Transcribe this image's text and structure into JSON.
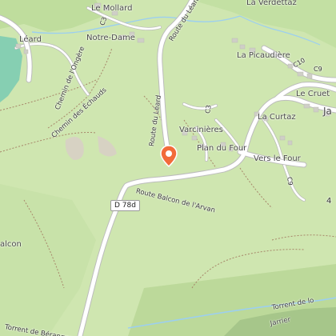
{
  "map": {
    "places": [
      {
        "id": "le-mollard",
        "name": "Le Mollard"
      },
      {
        "id": "la-verdettaz",
        "name": "La Verdettaz"
      },
      {
        "id": "leard",
        "name": "Léard"
      },
      {
        "id": "notre-dame",
        "name": "Notre-Dame"
      },
      {
        "id": "la-picaudiere",
        "name": "La Picaudière"
      },
      {
        "id": "le-cruet",
        "name": "Le Cruet"
      },
      {
        "id": "la-curtaz",
        "name": "La Curtaz"
      },
      {
        "id": "varcinieres",
        "name": "Varcinières"
      },
      {
        "id": "plan-du-four",
        "name": "Plan du Four"
      },
      {
        "id": "vers-le-four",
        "name": "Vers le Four"
      },
      {
        "id": "balcon",
        "name": "alcon"
      },
      {
        "id": "jarrier-partial",
        "name": "Ja"
      },
      {
        "id": "jarrier",
        "name": "Jarrier"
      }
    ],
    "roads": [
      {
        "id": "route-du-leard-top",
        "name": "Route du Léard"
      },
      {
        "id": "route-du-leard-mid",
        "name": "Route du Léard"
      },
      {
        "id": "chemin-ongere",
        "name": "Chemin de l'Ongère"
      },
      {
        "id": "chemin-echauds",
        "name": "Chemin des Échauds"
      },
      {
        "id": "route-balcon",
        "name": "Route Balcon de l'Arvan"
      },
      {
        "id": "torrent-beranger",
        "name": "Torrent de Béranger"
      },
      {
        "id": "torrent-lo",
        "name": "Torrent de lo"
      }
    ],
    "shields": {
      "d78d": "D 78d",
      "c3_top": "C3",
      "c3_mid": "C3",
      "c9_top": "C9",
      "c9_mid": "C9",
      "c10": "C10",
      "edge_4": "4"
    },
    "marker": {
      "icon": "map-pin-icon",
      "color": "#f26b3a"
    },
    "colors": {
      "land": "#cfe6b0",
      "water": "#8fd3b5",
      "road": "#ffffff",
      "road_edge": "#b9b9b9",
      "building": "#cfcfc7",
      "river": "#9ccff0"
    }
  }
}
